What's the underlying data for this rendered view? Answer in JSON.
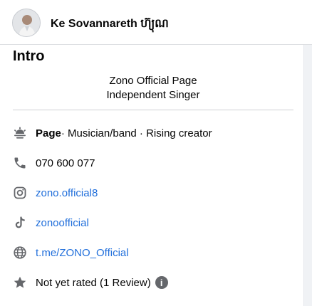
{
  "header": {
    "user_name": "Ke Sovannareth ហ៊្យុណ"
  },
  "intro": {
    "title": "Intro",
    "bio_lines": [
      "Zono Official Page",
      "Independent Singer"
    ]
  },
  "details": {
    "category": {
      "icon": "category-icon",
      "label": "Page",
      "value": " · Musician/band · Rising creator"
    },
    "phone": {
      "icon": "phone-icon",
      "value": "070 600 077"
    },
    "instagram": {
      "icon": "instagram-icon",
      "value": "zono.official8"
    },
    "tiktok": {
      "icon": "tiktok-icon",
      "value": "zonoofficial"
    },
    "website": {
      "icon": "globe-icon",
      "value": "t.me/ZONO_Official"
    },
    "rating": {
      "icon": "star-icon",
      "value": "Not yet rated (1 Review)",
      "info_icon": "info-icon",
      "info_glyph": "i"
    }
  },
  "colors": {
    "link": "#216fdb",
    "icon": "#65676b",
    "background": "#f0f2f5"
  }
}
